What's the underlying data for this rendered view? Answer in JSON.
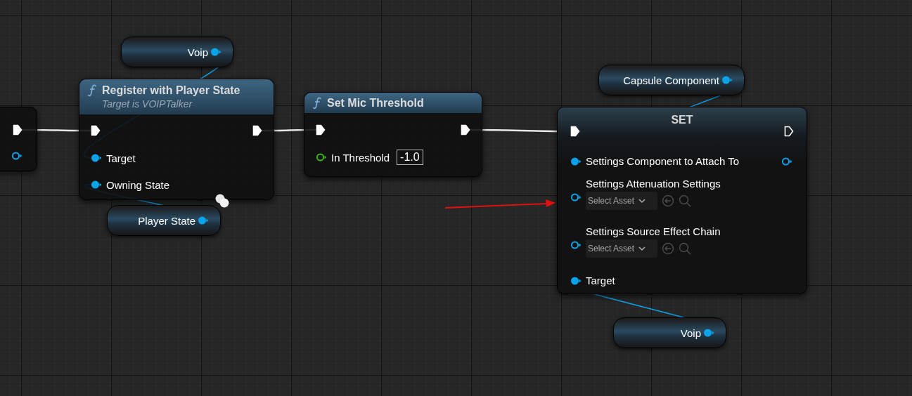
{
  "nodes": [
    {
      "kind": "stub",
      "exec_out_connected": true,
      "pins": [
        {
          "kind": "object",
          "connected": false
        }
      ]
    },
    {
      "kind": "getter",
      "label": "Voip",
      "connected": true
    },
    {
      "kind": "function",
      "title": "Register with Player State",
      "subtitle": "Target is VOIPTalker",
      "exec_in_connected": true,
      "exec_out_connected": true,
      "pins": [
        {
          "label": "Target",
          "kind": "object",
          "connected": true
        },
        {
          "label": "Owning State",
          "kind": "object",
          "connected": true
        }
      ]
    },
    {
      "kind": "getter",
      "label": "Player State",
      "connected": true
    },
    {
      "kind": "function",
      "title": "Set Mic Threshold",
      "exec_in_connected": true,
      "exec_out_connected": true,
      "pins": [
        {
          "label": "In Threshold",
          "kind": "float",
          "connected": false,
          "value": "-1.0"
        }
      ]
    },
    {
      "kind": "getter",
      "label": "Capsule Component",
      "connected": true
    },
    {
      "kind": "set",
      "title": "SET",
      "exec_in_connected": true,
      "exec_out_connected": false,
      "pins": [
        {
          "label": "Settings Component to Attach To",
          "kind": "object",
          "connected": true,
          "output_connected": false
        },
        {
          "label": "Settings Attenuation Settings",
          "kind": "object",
          "connected": false,
          "asset": "Select Asset"
        },
        {
          "label": "Settings Source Effect Chain",
          "kind": "object",
          "connected": false,
          "asset": "Select Asset"
        },
        {
          "label": "Target",
          "kind": "object",
          "connected": true
        }
      ]
    },
    {
      "kind": "getter",
      "label": "Voip",
      "connected": true
    }
  ]
}
